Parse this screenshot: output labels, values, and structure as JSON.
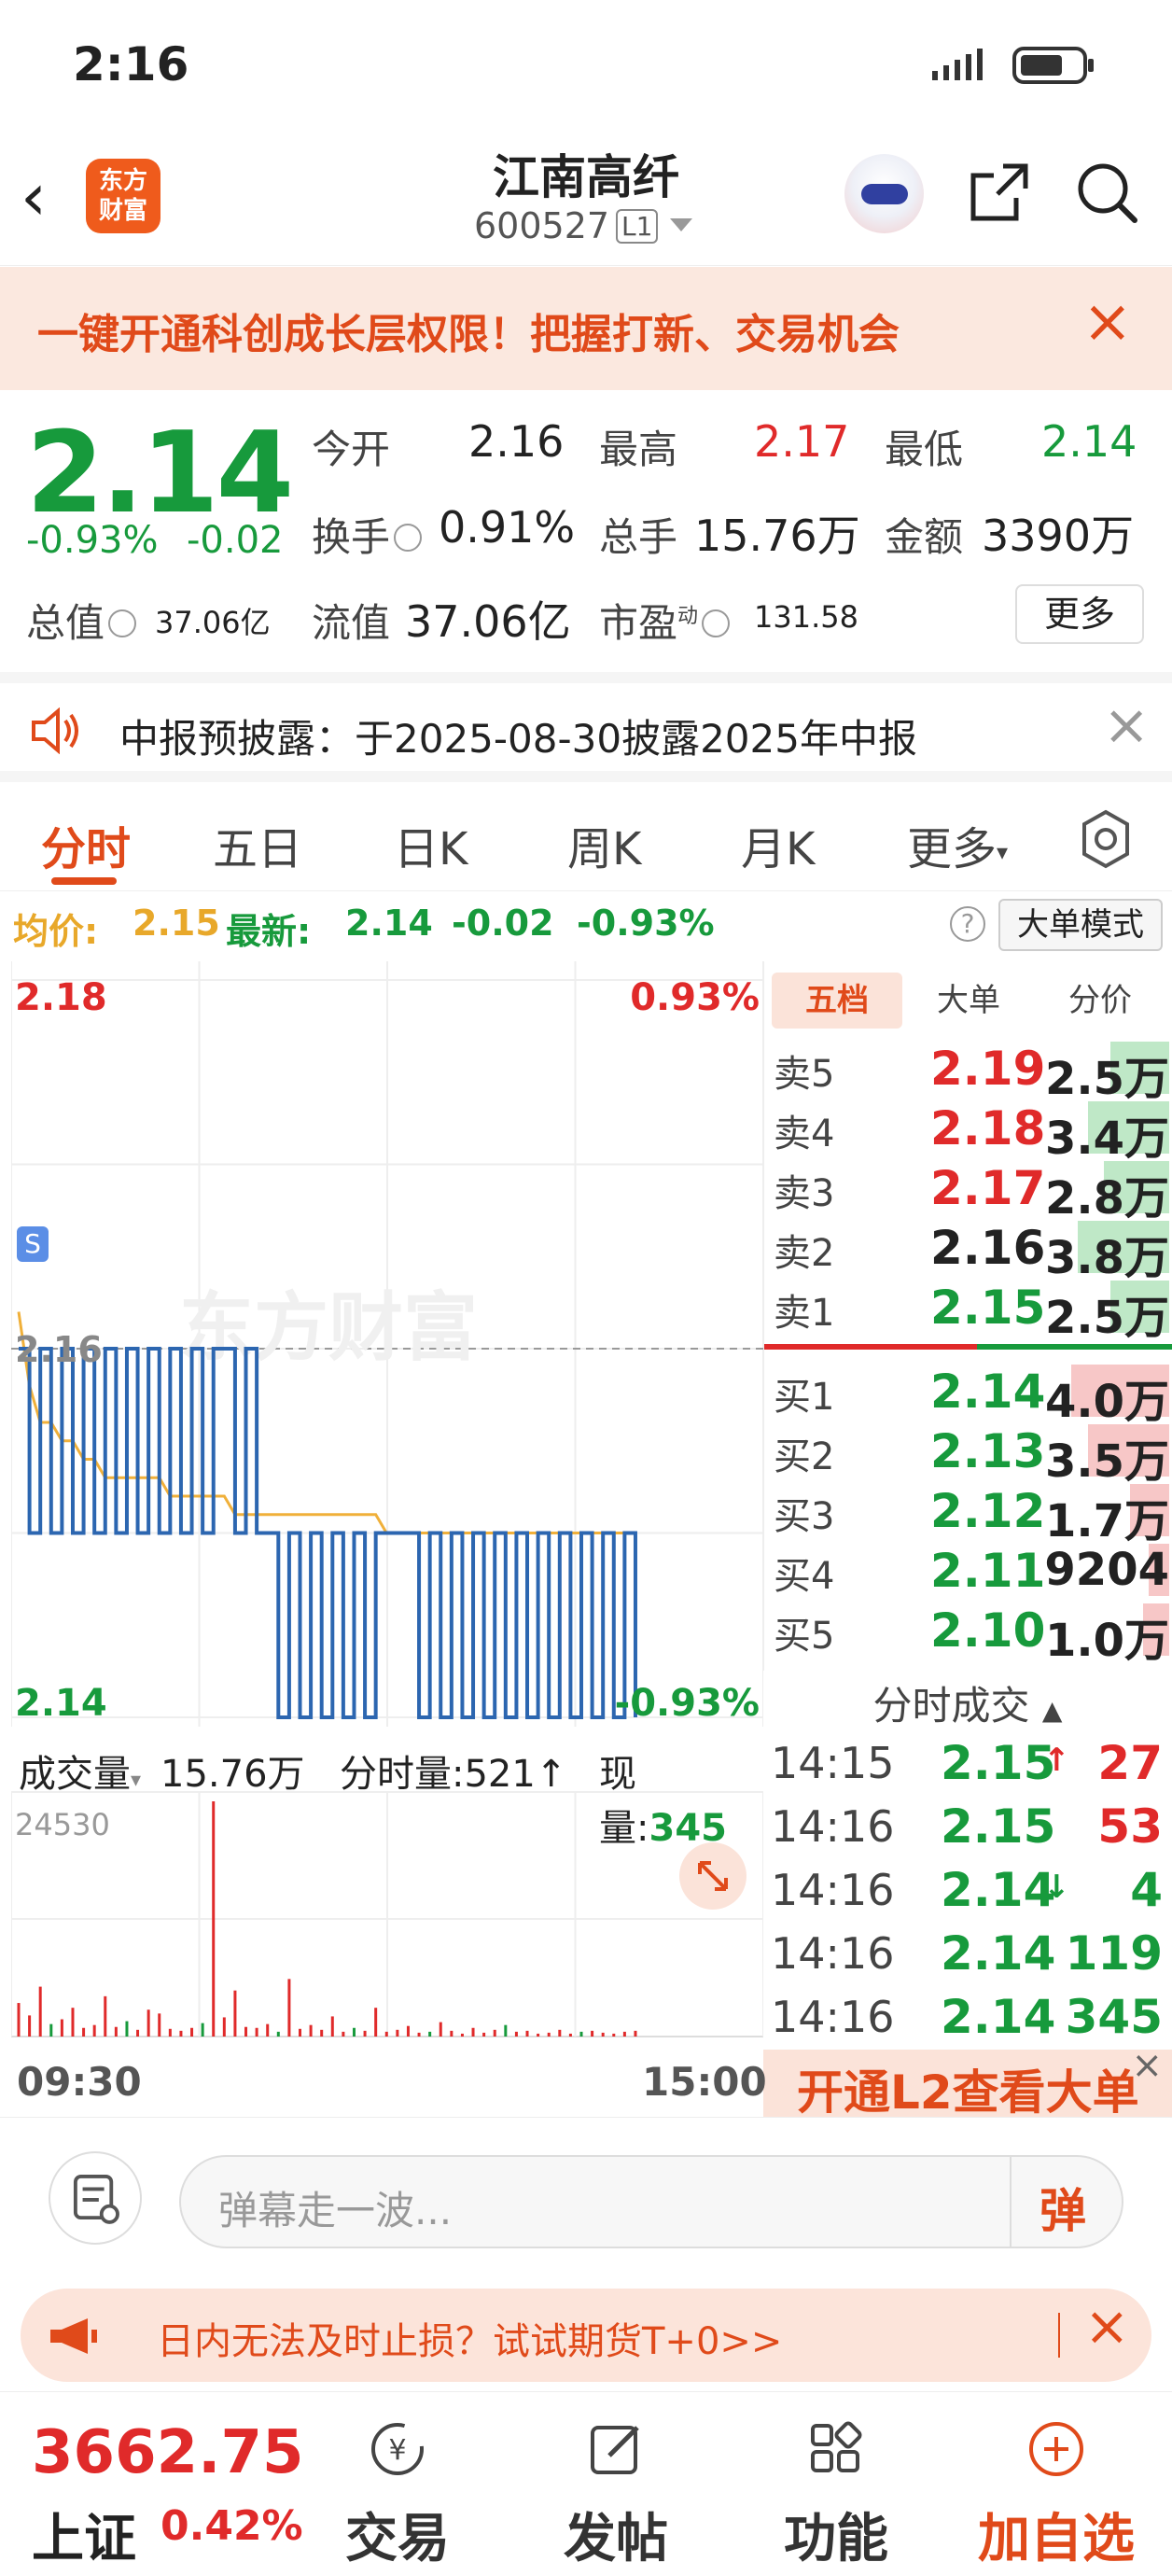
{
  "status": {
    "time": "2:16"
  },
  "header": {
    "logo_text": "东方\n财富",
    "stock_name": "江南高纤",
    "stock_code": "600527",
    "level_badge": "L1"
  },
  "promo": {
    "text": "一键开通科创成长层权限！把握打新、交易机会"
  },
  "quote": {
    "price": "2.14",
    "change_pct": "-0.93%",
    "change": "-0.02",
    "open_label": "今开",
    "open": "2.16",
    "high_label": "最高",
    "high": "2.17",
    "low_label": "最低",
    "low": "2.14",
    "turnover_label": "换手",
    "turnover": "0.91%",
    "volume_label": "总手",
    "volume": "15.76万",
    "amount_label": "金额",
    "amount": "3390万",
    "mktcap_label": "总值",
    "mktcap": "37.06亿",
    "float_label": "流值",
    "float_cap": "37.06亿",
    "pe_label": "市盈",
    "pe_sup": "动",
    "pe": "131.58",
    "more_label": "更多"
  },
  "notice": {
    "text": "中报预披露：于2025-08-30披露2025年中报"
  },
  "tabs": [
    {
      "label": "分时",
      "active": true
    },
    {
      "label": "五日"
    },
    {
      "label": "日K"
    },
    {
      "label": "周K"
    },
    {
      "label": "月K"
    },
    {
      "label": "更多"
    }
  ],
  "avgrow": {
    "avg_label": "均价:",
    "avg": "2.15",
    "last_label": "最新:",
    "last": "2.14",
    "chg": "-0.02",
    "pct": "-0.93%",
    "help": "?",
    "mode_button": "大单模式"
  },
  "chart_data": {
    "type": "line",
    "title": "",
    "y_max_label": "2.18",
    "y_min_label": "2.14",
    "pct_max_label": "0.93%",
    "pct_min_label": "-0.93%",
    "prev_close_label": "2.16",
    "ylim": [
      2.14,
      2.18
    ],
    "prev_close": 2.16,
    "marker": "S",
    "watermark": "东方财富",
    "series": [
      {
        "name": "price",
        "color": "#2c66b0"
      },
      {
        "name": "avg",
        "color": "#f0b03a"
      }
    ],
    "price_values": [
      2.16,
      2.15,
      2.16,
      2.15,
      2.16,
      2.15,
      2.16,
      2.15,
      2.16,
      2.15,
      2.16,
      2.15,
      2.16,
      2.15,
      2.16,
      2.15,
      2.16,
      2.15,
      2.16,
      2.16,
      2.15,
      2.16,
      2.15,
      2.15,
      2.14,
      2.15,
      2.14,
      2.15,
      2.14,
      2.15,
      2.14,
      2.15,
      2.14,
      2.15,
      2.15,
      2.15,
      2.15,
      2.14,
      2.15,
      2.14,
      2.15,
      2.14,
      2.15,
      2.14,
      2.15,
      2.14,
      2.15,
      2.14,
      2.15,
      2.14,
      2.15,
      2.14,
      2.15,
      2.14,
      2.15,
      2.14,
      2.15,
      2.14
    ],
    "avg_values": [
      2.162,
      2.158,
      2.156,
      2.156,
      2.155,
      2.155,
      2.154,
      2.154,
      2.153,
      2.153,
      2.153,
      2.153,
      2.153,
      2.153,
      2.152,
      2.152,
      2.152,
      2.152,
      2.152,
      2.152,
      2.151,
      2.151,
      2.151,
      2.151,
      2.151,
      2.151,
      2.151,
      2.151,
      2.151,
      2.151,
      2.151,
      2.151,
      2.151,
      2.151,
      2.15,
      2.15,
      2.15,
      2.15,
      2.15,
      2.15,
      2.15,
      2.15,
      2.15,
      2.15,
      2.15,
      2.15,
      2.15,
      2.15,
      2.15,
      2.15,
      2.15,
      2.15,
      2.15,
      2.15,
      2.15,
      2.15,
      2.15,
      2.15
    ],
    "volume_max_label": "24530",
    "volume_values": [
      3500,
      2200,
      5200,
      1300,
      1800,
      3000,
      900,
      1200,
      4200,
      1000,
      1600,
      700,
      2800,
      2400,
      800,
      600,
      900,
      1400,
      24530,
      2000,
      4800,
      1000,
      900,
      1300,
      500,
      6000,
      800,
      1200,
      700,
      2100,
      500,
      900,
      600,
      3000,
      500,
      700,
      1100,
      400,
      500,
      1500,
      600,
      300,
      900,
      400,
      700,
      1200,
      500,
      600,
      300,
      400,
      700,
      300,
      500,
      600,
      400,
      300,
      500,
      600
    ]
  },
  "volbar": {
    "label": "成交量",
    "total": "15.76万",
    "minute_label": "分时量:",
    "minute": "521↑",
    "now_label": "现量:",
    "now": "345"
  },
  "book": {
    "tabs": [
      "五档",
      "大单",
      "分价"
    ],
    "asks": [
      {
        "label": "卖5",
        "price": "2.19",
        "vol": "2.5万",
        "color": "red",
        "bar": 0.45
      },
      {
        "label": "卖4",
        "price": "2.18",
        "vol": "3.4万",
        "color": "red",
        "bar": 0.62
      },
      {
        "label": "卖3",
        "price": "2.17",
        "vol": "2.8万",
        "color": "red",
        "bar": 0.5
      },
      {
        "label": "卖2",
        "price": "2.16",
        "vol": "3.8万",
        "color": "black",
        "bar": 0.7
      },
      {
        "label": "卖1",
        "price": "2.15",
        "vol": "2.5万",
        "color": "green",
        "bar": 0.45
      }
    ],
    "bids": [
      {
        "label": "买1",
        "price": "2.14",
        "vol": "4.0万",
        "color": "green",
        "bar": 0.75
      },
      {
        "label": "买2",
        "price": "2.13",
        "vol": "3.5万",
        "color": "green",
        "bar": 0.62
      },
      {
        "label": "买3",
        "price": "2.12",
        "vol": "1.7万",
        "color": "green",
        "bar": 0.3
      },
      {
        "label": "买4",
        "price": "2.11",
        "vol": "9204",
        "color": "green",
        "bar": 0.16
      },
      {
        "label": "买5",
        "price": "2.10",
        "vol": "1.0万",
        "color": "green",
        "bar": 0.2
      }
    ]
  },
  "ticks": {
    "header": "分时成交",
    "rows": [
      {
        "time": "14:15",
        "price": "2.15",
        "arrow": "↑",
        "qty": "27",
        "qcolor": "red"
      },
      {
        "time": "14:16",
        "price": "2.15",
        "arrow": "",
        "qty": "53",
        "qcolor": "red"
      },
      {
        "time": "14:16",
        "price": "2.14",
        "arrow": "↓",
        "qty": "4",
        "qcolor": "green"
      },
      {
        "time": "14:16",
        "price": "2.14",
        "arrow": "",
        "qty": "119",
        "qcolor": "green"
      },
      {
        "time": "14:16",
        "price": "2.14",
        "arrow": "",
        "qty": "345",
        "qcolor": "green"
      }
    ]
  },
  "l2": {
    "text": "开通L2查看大单"
  },
  "timeaxis": {
    "start": "09:30",
    "end": "15:00"
  },
  "comment": {
    "placeholder": "弹幕走一波...",
    "danmu_label": "弹"
  },
  "ad": {
    "text": "日内无法及时止损？试试期货T+0>>"
  },
  "bottom": {
    "index_value": "3662.75",
    "index_name": "上证",
    "index_pct": "0.42%",
    "nav": [
      {
        "label": "交易",
        "icon": "trade-icon"
      },
      {
        "label": "发帖",
        "icon": "edit-icon"
      },
      {
        "label": "功能",
        "icon": "grid-icon"
      },
      {
        "label": "加自选",
        "icon": "plus-circle-icon"
      }
    ]
  }
}
